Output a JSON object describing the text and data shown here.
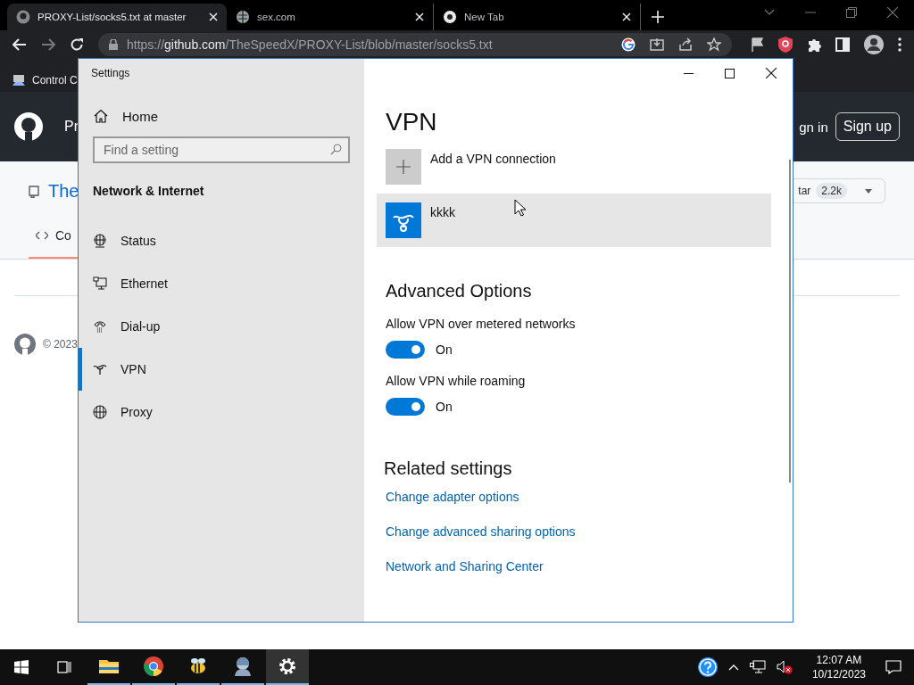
{
  "browser": {
    "tabs": [
      {
        "title": "PROXY-List/socks5.txt at master",
        "kind": "github",
        "selected": true
      },
      {
        "title": "sex.com",
        "kind": "globe",
        "selected": false
      },
      {
        "title": "New Tab",
        "kind": "chrome",
        "selected": false
      }
    ],
    "address": {
      "scheme": "https://",
      "host": "github.com",
      "path": "/TheSpeedX/PROXY-List/blob/master/socks5.txt"
    },
    "bookmarks": [
      "Control C"
    ]
  },
  "page": {
    "nav_text": "Pr",
    "sign_in": "gn in",
    "sign_up": "Sign up",
    "repo": "The",
    "code_tab": "Co",
    "star": "tar",
    "star_count": "2.2k",
    "footer": "© 2023"
  },
  "settings": {
    "title": "Settings",
    "home": "Home",
    "search": {
      "placeholder": "Find a setting"
    },
    "section": "Network & Internet",
    "nav": [
      {
        "label": "Status",
        "kind": "status",
        "selected": false
      },
      {
        "label": "Ethernet",
        "kind": "ethernet",
        "selected": false
      },
      {
        "label": "Dial-up",
        "kind": "dialup",
        "selected": false
      },
      {
        "label": "VPN",
        "kind": "vpn",
        "selected": true
      },
      {
        "label": "Proxy",
        "kind": "proxy",
        "selected": false
      }
    ],
    "heading": "VPN",
    "add_label": "Add a VPN connection",
    "connections": [
      {
        "name": "kkkk",
        "selected": true
      }
    ],
    "advanced": {
      "heading": "Advanced Options",
      "toggles": [
        {
          "label": "Allow VPN over metered networks",
          "on": true,
          "state": "On"
        },
        {
          "label": "Allow VPN while roaming",
          "on": true,
          "state": "On"
        }
      ]
    },
    "related": {
      "heading": "Related settings",
      "links": [
        "Change adapter options",
        "Change advanced sharing options",
        "Network and Sharing Center"
      ]
    }
  },
  "taskbar": {
    "apps": [
      {
        "kind": "explorer",
        "selected": false
      },
      {
        "kind": "chrome",
        "selected": false
      },
      {
        "kind": "bee",
        "selected": false
      },
      {
        "kind": "figure",
        "selected": false
      },
      {
        "kind": "settings",
        "selected": true
      }
    ],
    "clock": {
      "time": "12:07 AM",
      "date": "10/12/2023"
    }
  }
}
